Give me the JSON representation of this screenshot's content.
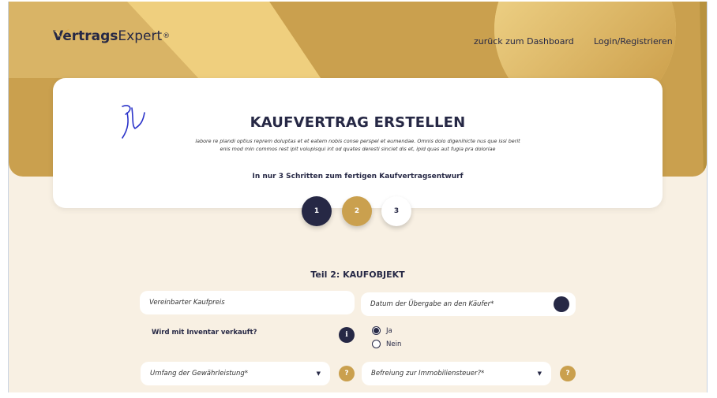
{
  "header": {
    "logo_bold": "Vertrags",
    "logo_light": "Expert",
    "logo_reg": "®",
    "nav_dashboard": "zurück zum Dashboard",
    "nav_login": "Login/Registrieren"
  },
  "card": {
    "title": "KAUFVERTRAG ERSTELLEN",
    "description": "labore re plandi optius reprem doluptas et et eatem nobis conse perspel et eumendae. Omnis dolo digenihicte nus que issi berit enis mod min commos rest ipit volupisqui int od quates deresti sinciet dis et, ipid quas aut fugia pra doloriae",
    "steps_label": "In nur 3 Schritten zum fertigen Kaufvertragsentwurf"
  },
  "steps": [
    "1",
    "2",
    "3"
  ],
  "colors": {
    "navy": "#262845",
    "gold": "#caa04e",
    "cream": "#f8f0e3"
  },
  "form": {
    "section_title": "Teil 2: KAUFOBJEKT",
    "price_placeholder": "Vereinbarter Kaufpreis",
    "date_placeholder": "Datum der Übergabe an den Käufer*",
    "inventory_question": "Wird mit Inventar verkauft?",
    "info_icon": "i",
    "radio_yes": "Ja",
    "radio_no": "Nein",
    "warranty_select": "Umfang der Gewährleistung*",
    "tax_select": "Befreiung zur Immobiliensteuer?*",
    "caret": "▼",
    "help_icon": "?"
  }
}
